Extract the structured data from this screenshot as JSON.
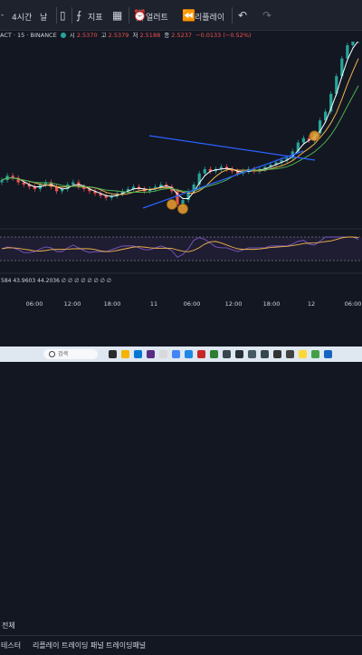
{
  "toolbar": {
    "left_partial": "-",
    "interval": "4시간",
    "day_partial": "날",
    "indicators_label": "지표",
    "alert_label": "얼러트",
    "replay_label": "리플레이",
    "undo_icon": "undo-icon",
    "redo_icon": "redo-icon"
  },
  "symbol": {
    "name": "ACT · 15 · BINANCE",
    "open_label": "시",
    "open": "2.5370",
    "high_label": "고",
    "high": "2.5379",
    "low_label": "저",
    "low": "2.5188",
    "close_label": "종",
    "close": "2.5237",
    "change": "−0.0133 (−0.52%)"
  },
  "oscillator": {
    "values_text": "584  43.9603  44.2036  ∅ ∅ ∅ ∅ ∅ ∅ ∅ ∅"
  },
  "time_axis": {
    "labels": [
      "06:00",
      "12:00",
      "18:00",
      "11",
      "06:00",
      "12:00",
      "18:00",
      "12",
      "06:00"
    ]
  },
  "bottom": {
    "scope_label": "전체",
    "tabs": [
      "테스터",
      "리플레이 트레이딩 패널",
      "트레이딩패널"
    ]
  },
  "taskbar": {
    "search_placeholder": "검색"
  },
  "colors": {
    "background": "#131722",
    "candle_up": "#26a69a",
    "candle_down": "#ef5350",
    "ma_fast": "#ffffff",
    "ma_mid": "#f0b34a",
    "ma_slow": "#4caf50",
    "trendline": "#2962ff",
    "marker": "#f0a030",
    "osc_line": "#7e57c2",
    "osc_signal": "#f0b34a"
  },
  "chart_data": {
    "type": "candlestick",
    "series": [
      {
        "name": "close",
        "values": [
          2.25,
          2.27,
          2.26,
          2.24,
          2.23,
          2.22,
          2.21,
          2.23,
          2.24,
          2.22,
          2.2,
          2.21,
          2.23,
          2.24,
          2.22,
          2.21,
          2.2,
          2.19,
          2.18,
          2.17,
          2.18,
          2.19,
          2.2,
          2.21,
          2.22,
          2.21,
          2.2,
          2.21,
          2.22,
          2.23,
          2.22,
          2.2,
          2.14,
          2.16,
          2.2,
          2.23,
          2.28,
          2.3,
          2.29,
          2.3,
          2.31,
          2.3,
          2.29,
          2.28,
          2.29,
          2.3,
          2.29,
          2.3,
          2.31,
          2.32,
          2.33,
          2.34,
          2.35,
          2.38,
          2.42,
          2.44,
          2.43,
          2.46,
          2.52,
          2.56,
          2.64,
          2.72,
          2.8,
          2.86,
          2.88,
          2.9
        ]
      }
    ],
    "markers": [
      {
        "index": 31,
        "price": 2.14
      },
      {
        "index": 33,
        "price": 2.12
      },
      {
        "index": 57,
        "price": 2.45
      }
    ]
  }
}
